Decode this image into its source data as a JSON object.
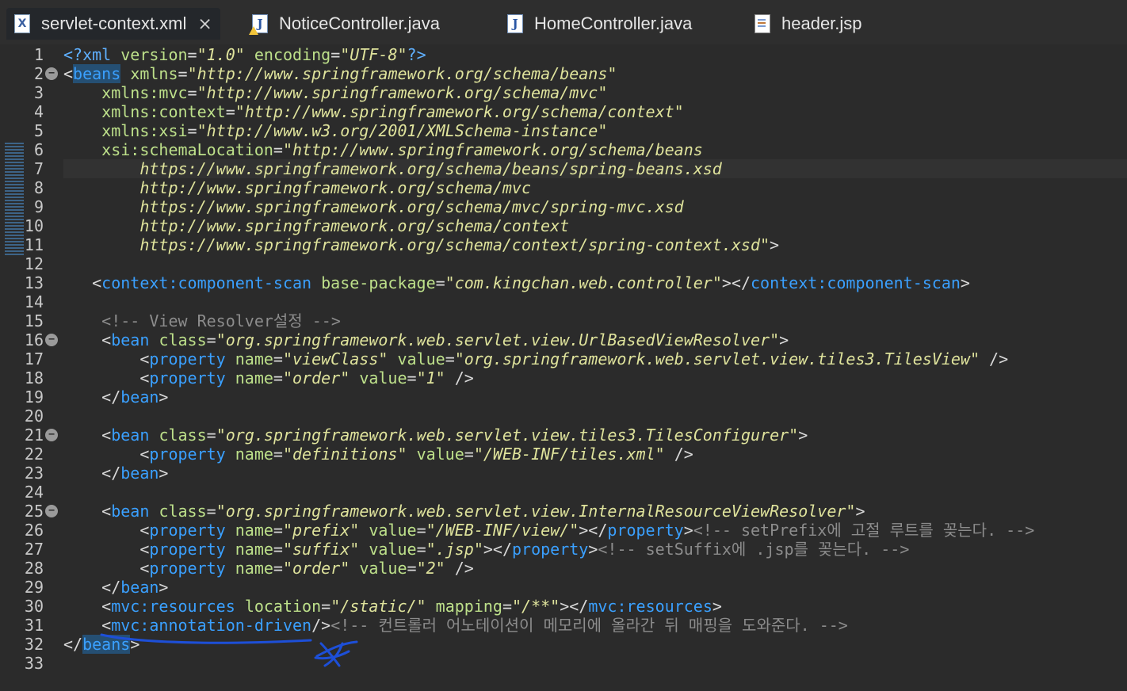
{
  "tabs": [
    {
      "label": "servlet-context.xml",
      "icon": "xml-file-icon",
      "active": true
    },
    {
      "label": "NoticeController.java",
      "icon": "java-file-warning-icon",
      "active": false
    },
    {
      "label": "HomeController.java",
      "icon": "java-file-icon",
      "active": false
    },
    {
      "label": "header.jsp",
      "icon": "jsp-file-icon",
      "active": false
    }
  ],
  "colors": {
    "background": "#2b2b2b",
    "tag": "#3aa0ff",
    "attribute": "#bde08a",
    "string": "#dfe39c",
    "comment": "#8c8c8c",
    "annotation_ink": "#1d4fd8"
  },
  "current_line": 7,
  "folded_lines": [
    2,
    16,
    21,
    25
  ],
  "lines": [
    {
      "n": "1",
      "tokens": [
        [
          "pi",
          "<?xml "
        ],
        [
          "at",
          "version"
        ],
        [
          "pun",
          "="
        ],
        [
          "str",
          "\"1.0\""
        ],
        [
          "pun",
          " "
        ],
        [
          "at",
          "encoding"
        ],
        [
          "pun",
          "="
        ],
        [
          "str",
          "\"UTF-8\""
        ],
        [
          "pi",
          "?>"
        ]
      ]
    },
    {
      "n": "2",
      "tokens": [
        [
          "pun",
          "<"
        ],
        [
          "tag",
          "beans"
        ],
        [
          "pun",
          " "
        ],
        [
          "at",
          "xmlns"
        ],
        [
          "pun",
          "="
        ],
        [
          "str",
          "\"http://www.springframework.org/schema/beans\""
        ]
      ]
    },
    {
      "n": "3",
      "tokens": [
        [
          "pun",
          "    "
        ],
        [
          "at",
          "xmlns:mvc"
        ],
        [
          "pun",
          "="
        ],
        [
          "str",
          "\"http://www.springframework.org/schema/mvc\""
        ]
      ]
    },
    {
      "n": "4",
      "tokens": [
        [
          "pun",
          "    "
        ],
        [
          "at",
          "xmlns:context"
        ],
        [
          "pun",
          "="
        ],
        [
          "str",
          "\"http://www.springframework.org/schema/context\""
        ]
      ]
    },
    {
      "n": "5",
      "tokens": [
        [
          "pun",
          "    "
        ],
        [
          "at",
          "xmlns:xsi"
        ],
        [
          "pun",
          "="
        ],
        [
          "str",
          "\"http://www.w3.org/2001/XMLSchema-instance\""
        ]
      ]
    },
    {
      "n": "6",
      "tokens": [
        [
          "pun",
          "    "
        ],
        [
          "at",
          "xsi:schemaLocation"
        ],
        [
          "pun",
          "="
        ],
        [
          "str",
          "\"http://www.springframework.org/schema/beans"
        ]
      ]
    },
    {
      "n": "7",
      "tokens": [
        [
          "pun",
          "        "
        ],
        [
          "str",
          "https://www.springframework.org/schema/beans/spring-beans.xsd"
        ]
      ]
    },
    {
      "n": "8",
      "tokens": [
        [
          "pun",
          "        "
        ],
        [
          "str",
          "http://www.springframework.org/schema/mvc"
        ]
      ]
    },
    {
      "n": "9",
      "tokens": [
        [
          "pun",
          "        "
        ],
        [
          "str",
          "https://www.springframework.org/schema/mvc/spring-mvc.xsd"
        ]
      ]
    },
    {
      "n": "10",
      "tokens": [
        [
          "pun",
          "        "
        ],
        [
          "str",
          "http://www.springframework.org/schema/context"
        ]
      ]
    },
    {
      "n": "11",
      "tokens": [
        [
          "pun",
          "        "
        ],
        [
          "str",
          "https://www.springframework.org/schema/context/spring-context.xsd\""
        ],
        [
          "pun",
          ">"
        ]
      ]
    },
    {
      "n": "12",
      "tokens": []
    },
    {
      "n": "13",
      "tokens": [
        [
          "pun",
          "   <"
        ],
        [
          "tag",
          "context:component-scan"
        ],
        [
          "pun",
          " "
        ],
        [
          "at",
          "base-package"
        ],
        [
          "pun",
          "="
        ],
        [
          "str",
          "\"com.kingchan.web.controller\""
        ],
        [
          "pun",
          "></"
        ],
        [
          "tag",
          "context:component-scan"
        ],
        [
          "pun",
          ">"
        ]
      ]
    },
    {
      "n": "14",
      "tokens": []
    },
    {
      "n": "15",
      "tokens": [
        [
          "pun",
          "    "
        ],
        [
          "com",
          "<!-- View Resolver설정 -->"
        ]
      ]
    },
    {
      "n": "16",
      "tokens": [
        [
          "pun",
          "    <"
        ],
        [
          "tag",
          "bean"
        ],
        [
          "pun",
          " "
        ],
        [
          "at",
          "class"
        ],
        [
          "pun",
          "="
        ],
        [
          "str",
          "\"org.springframework.web.servlet.view.UrlBasedViewResolver\""
        ],
        [
          "pun",
          ">"
        ]
      ]
    },
    {
      "n": "17",
      "tokens": [
        [
          "pun",
          "        <"
        ],
        [
          "tag",
          "property"
        ],
        [
          "pun",
          " "
        ],
        [
          "at",
          "name"
        ],
        [
          "pun",
          "="
        ],
        [
          "str",
          "\"viewClass\""
        ],
        [
          "pun",
          " "
        ],
        [
          "at",
          "value"
        ],
        [
          "pun",
          "="
        ],
        [
          "str",
          "\"org.springframework.web.servlet.view.tiles3.TilesView\""
        ],
        [
          "pun",
          " />"
        ]
      ]
    },
    {
      "n": "18",
      "tokens": [
        [
          "pun",
          "        <"
        ],
        [
          "tag",
          "property"
        ],
        [
          "pun",
          " "
        ],
        [
          "at",
          "name"
        ],
        [
          "pun",
          "="
        ],
        [
          "str",
          "\"order\""
        ],
        [
          "pun",
          " "
        ],
        [
          "at",
          "value"
        ],
        [
          "pun",
          "="
        ],
        [
          "str",
          "\"1\""
        ],
        [
          "pun",
          " />"
        ]
      ]
    },
    {
      "n": "19",
      "tokens": [
        [
          "pun",
          "    </"
        ],
        [
          "tag",
          "bean"
        ],
        [
          "pun",
          ">"
        ]
      ]
    },
    {
      "n": "20",
      "tokens": []
    },
    {
      "n": "21",
      "tokens": [
        [
          "pun",
          "    <"
        ],
        [
          "tag",
          "bean"
        ],
        [
          "pun",
          " "
        ],
        [
          "at",
          "class"
        ],
        [
          "pun",
          "="
        ],
        [
          "str",
          "\"org.springframework.web.servlet.view.tiles3.TilesConfigurer\""
        ],
        [
          "pun",
          ">"
        ]
      ]
    },
    {
      "n": "22",
      "tokens": [
        [
          "pun",
          "        <"
        ],
        [
          "tag",
          "property"
        ],
        [
          "pun",
          " "
        ],
        [
          "at",
          "name"
        ],
        [
          "pun",
          "="
        ],
        [
          "str",
          "\"definitions\""
        ],
        [
          "pun",
          " "
        ],
        [
          "at",
          "value"
        ],
        [
          "pun",
          "="
        ],
        [
          "str",
          "\"/WEB-INF/tiles.xml\""
        ],
        [
          "pun",
          " />"
        ]
      ]
    },
    {
      "n": "23",
      "tokens": [
        [
          "pun",
          "    </"
        ],
        [
          "tag",
          "bean"
        ],
        [
          "pun",
          ">"
        ]
      ]
    },
    {
      "n": "24",
      "tokens": []
    },
    {
      "n": "25",
      "tokens": [
        [
          "pun",
          "    <"
        ],
        [
          "tag",
          "bean"
        ],
        [
          "pun",
          " "
        ],
        [
          "at",
          "class"
        ],
        [
          "pun",
          "="
        ],
        [
          "str",
          "\"org.springframework.web.servlet.view.InternalResourceViewResolver\""
        ],
        [
          "pun",
          ">"
        ]
      ]
    },
    {
      "n": "26",
      "tokens": [
        [
          "pun",
          "        <"
        ],
        [
          "tag",
          "property"
        ],
        [
          "pun",
          " "
        ],
        [
          "at",
          "name"
        ],
        [
          "pun",
          "="
        ],
        [
          "str",
          "\"prefix\""
        ],
        [
          "pun",
          " "
        ],
        [
          "at",
          "value"
        ],
        [
          "pun",
          "="
        ],
        [
          "str",
          "\"/WEB-INF/view/\""
        ],
        [
          "pun",
          "></"
        ],
        [
          "tag",
          "property"
        ],
        [
          "pun",
          ">"
        ],
        [
          "com",
          "<!-- setPrefix에 고절 루트를 꽂는다. -->"
        ]
      ]
    },
    {
      "n": "27",
      "tokens": [
        [
          "pun",
          "        <"
        ],
        [
          "tag",
          "property"
        ],
        [
          "pun",
          " "
        ],
        [
          "at",
          "name"
        ],
        [
          "pun",
          "="
        ],
        [
          "str",
          "\"suffix\""
        ],
        [
          "pun",
          " "
        ],
        [
          "at",
          "value"
        ],
        [
          "pun",
          "="
        ],
        [
          "str",
          "\".jsp\""
        ],
        [
          "pun",
          "></"
        ],
        [
          "tag",
          "property"
        ],
        [
          "pun",
          ">"
        ],
        [
          "com",
          "<!-- setSuffix에 .jsp를 꽂는다. -->"
        ]
      ]
    },
    {
      "n": "28",
      "tokens": [
        [
          "pun",
          "        <"
        ],
        [
          "tag",
          "property"
        ],
        [
          "pun",
          " "
        ],
        [
          "at",
          "name"
        ],
        [
          "pun",
          "="
        ],
        [
          "str",
          "\"order\""
        ],
        [
          "pun",
          " "
        ],
        [
          "at",
          "value"
        ],
        [
          "pun",
          "="
        ],
        [
          "str",
          "\"2\""
        ],
        [
          "pun",
          " />"
        ]
      ]
    },
    {
      "n": "29",
      "tokens": [
        [
          "pun",
          "    </"
        ],
        [
          "tag",
          "bean"
        ],
        [
          "pun",
          ">"
        ]
      ]
    },
    {
      "n": "30",
      "tokens": [
        [
          "pun",
          "    <"
        ],
        [
          "tag",
          "mvc:resources"
        ],
        [
          "pun",
          " "
        ],
        [
          "at",
          "location"
        ],
        [
          "pun",
          "="
        ],
        [
          "str",
          "\"/static/\""
        ],
        [
          "pun",
          " "
        ],
        [
          "at",
          "mapping"
        ],
        [
          "pun",
          "="
        ],
        [
          "str",
          "\"/**\""
        ],
        [
          "pun",
          "></"
        ],
        [
          "tag",
          "mvc:resources"
        ],
        [
          "pun",
          ">"
        ]
      ]
    },
    {
      "n": "31",
      "tokens": [
        [
          "pun",
          "    <"
        ],
        [
          "tag",
          "mvc:annotation-driven"
        ],
        [
          "pun",
          "/>"
        ],
        [
          "com",
          "<!-- 컨트롤러 어노테이션이 메모리에 올라간 뒤 매핑을 도와준다. -->"
        ]
      ]
    },
    {
      "n": "32",
      "tokens": [
        [
          "pun",
          "</"
        ],
        [
          "tag",
          "beans"
        ],
        [
          "pun",
          ">"
        ]
      ]
    },
    {
      "n": "33",
      "tokens": []
    }
  ]
}
